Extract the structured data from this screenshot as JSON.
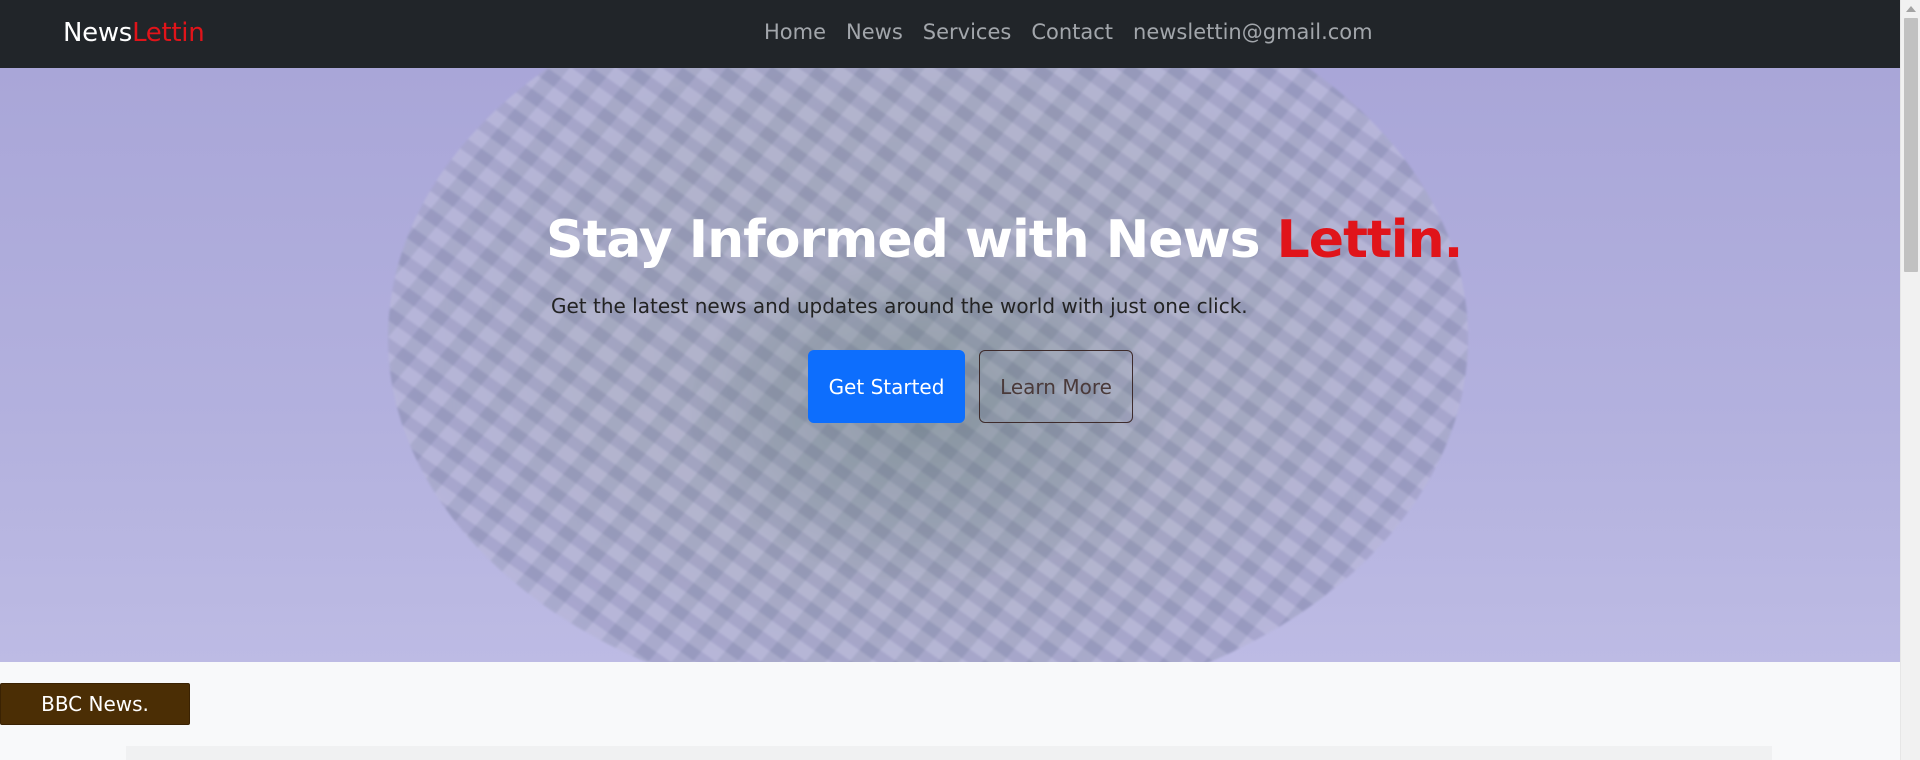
{
  "brand": {
    "part1": "News",
    "part2": "Lettin"
  },
  "nav": {
    "items": [
      {
        "label": "Home"
      },
      {
        "label": "News"
      },
      {
        "label": "Services"
      },
      {
        "label": "Contact"
      },
      {
        "label": "newslettin@gmail.com"
      }
    ]
  },
  "hero": {
    "title_main": "Stay Informed with News ",
    "title_accent": "Lettin.",
    "subtitle": "Get the latest news and updates around the world with just one click.",
    "primary_button": "Get Started",
    "secondary_button": "Learn More"
  },
  "section": {
    "label": "BBC News."
  },
  "colors": {
    "navbar_bg": "#212529",
    "accent_red": "#e0141a",
    "primary_blue": "#0d6efd",
    "label_brown": "#4b2e05",
    "hero_tint": "#aba8da"
  },
  "icons": {
    "scroll_up": "triangle-up-icon"
  }
}
